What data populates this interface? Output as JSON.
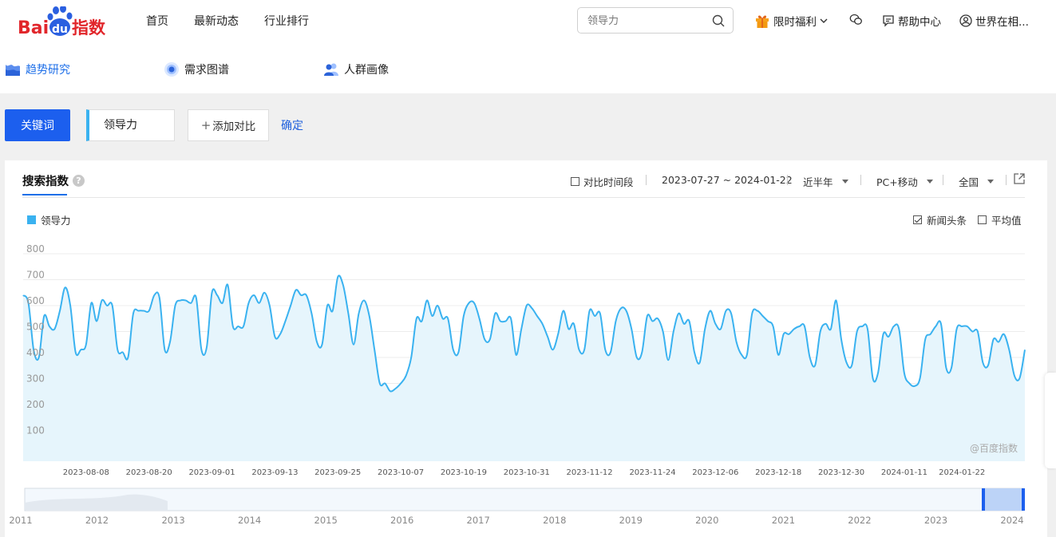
{
  "header": {
    "logo_text_left": "Bai",
    "logo_text_du": "du",
    "logo_text_right": "指数",
    "nav": [
      "首页",
      "最新动态",
      "行业排行"
    ],
    "search_placeholder": "领导力",
    "promo": "限时福利",
    "help": "帮助中心",
    "user": "世界在相..."
  },
  "subnav": {
    "tabs": [
      "趋势研究",
      "需求图谱",
      "人群画像"
    ]
  },
  "toolbar": {
    "keyword_button": "关键词",
    "keyword": "领导力",
    "add_compare": "添加对比",
    "confirm": "确定"
  },
  "panel": {
    "title": "搜索指数",
    "help": "?",
    "compare_period": "对比时间段",
    "date_range": "2023-07-27 ~ 2024-01-22",
    "period": "近半年",
    "device": "PC+移动",
    "region": "全国",
    "legend": "领导力",
    "news_label": "新闻头条",
    "avg_label": "平均值",
    "watermark": "@百度指数"
  },
  "colors": {
    "accent": "#1c5fee",
    "series": "#3ab2f0"
  },
  "chart_data": {
    "type": "area",
    "ylim": [
      0,
      800
    ],
    "yticks": [
      100,
      200,
      300,
      400,
      500,
      600,
      700,
      800
    ],
    "xticks": [
      "2023-08-08",
      "2023-08-20",
      "2023-09-01",
      "2023-09-13",
      "2023-09-25",
      "2023-10-07",
      "2023-10-19",
      "2023-10-31",
      "2023-11-12",
      "2023-11-24",
      "2023-12-06",
      "2023-12-18",
      "2023-12-30",
      "2024-01-11",
      "2024-01-22"
    ],
    "x_start": "2023-07-27",
    "series": [
      {
        "name": "领导力",
        "values": [
          640,
          610,
          430,
          400,
          560,
          520,
          510,
          580,
          670,
          600,
          420,
          430,
          450,
          610,
          540,
          620,
          600,
          600,
          430,
          420,
          400,
          570,
          580,
          580,
          580,
          640,
          630,
          430,
          460,
          600,
          620,
          620,
          610,
          630,
          430,
          440,
          650,
          640,
          610,
          680,
          520,
          520,
          520,
          610,
          640,
          610,
          650,
          600,
          480,
          490,
          540,
          600,
          660,
          640,
          640,
          570,
          460,
          450,
          600,
          580,
          710,
          680,
          570,
          450,
          570,
          620,
          560,
          430,
          300,
          300,
          270,
          280,
          300,
          330,
          400,
          550,
          540,
          620,
          560,
          600,
          550,
          550,
          430,
          420,
          560,
          610,
          610,
          550,
          470,
          470,
          570,
          540,
          540,
          550,
          410,
          510,
          600,
          590,
          560,
          530,
          480,
          430,
          490,
          580,
          510,
          530,
          430,
          430,
          580,
          560,
          570,
          430,
          420,
          540,
          590,
          580,
          510,
          400,
          420,
          560,
          540,
          550,
          500,
          390,
          500,
          570,
          530,
          540,
          420,
          380,
          510,
          580,
          530,
          510,
          580,
          570,
          460,
          410,
          410,
          570,
          580,
          560,
          540,
          520,
          410,
          490,
          490,
          510,
          520,
          520,
          400,
          370,
          500,
          530,
          510,
          620,
          470,
          380,
          370,
          500,
          520,
          510,
          320,
          340,
          490,
          480,
          520,
          510,
          340,
          300,
          290,
          320,
          470,
          490,
          520,
          530,
          360,
          360,
          510,
          520,
          520,
          500,
          500,
          380,
          370,
          470,
          460,
          490,
          430,
          330,
          320,
          430
        ]
      }
    ],
    "navigator_years": [
      "2011",
      "2012",
      "2013",
      "2014",
      "2015",
      "2016",
      "2017",
      "2018",
      "2019",
      "2020",
      "2021",
      "2022",
      "2023",
      "2024"
    ]
  }
}
